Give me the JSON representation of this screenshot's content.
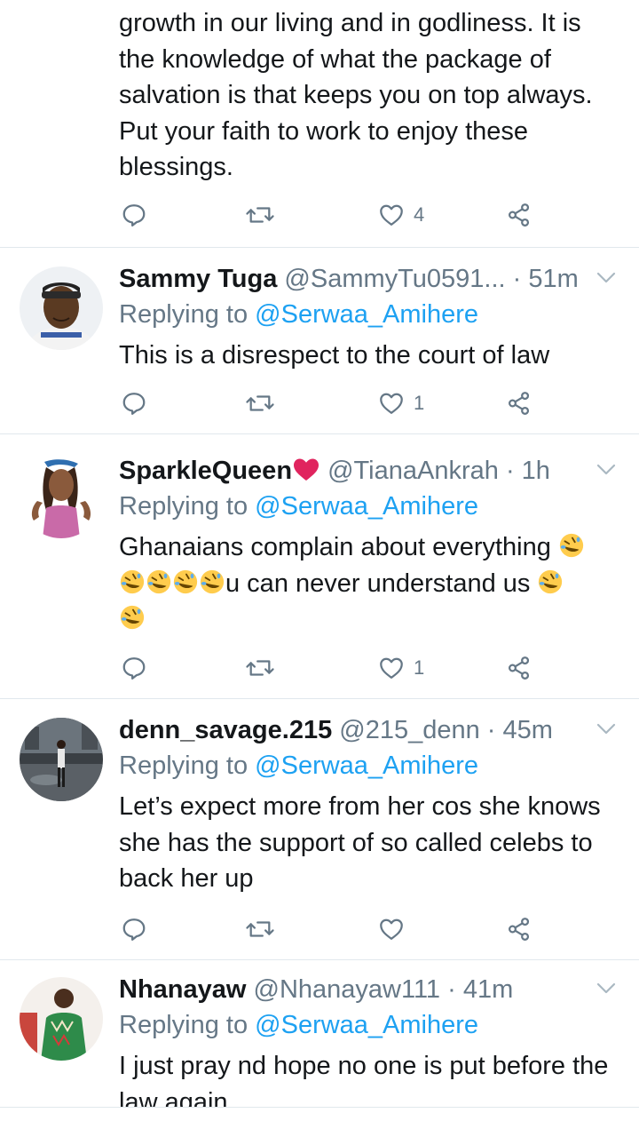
{
  "top_tweet": {
    "lines": [
      "growth in our living and in godliness. It is",
      "the knowledge of what the package of",
      "salvation is that keeps you on top always.",
      "Put your faith to work to enjoy these",
      "blessings."
    ],
    "likes": "4"
  },
  "replies": [
    {
      "name": "Sammy Tuga",
      "handle": "@SammyTu0591...",
      "time": "· 51m",
      "replying_prefix": "Replying to ",
      "replying_to": "@Serwaa_Amihere",
      "text": [
        "This is a disrespect to the court of law"
      ],
      "likes": "1"
    },
    {
      "name": "SparkleQueen",
      "handle": "@TianaAnkrah",
      "time": "· 1h",
      "replying_prefix": "Replying to ",
      "replying_to": "@Serwaa_Amihere",
      "text_parts": {
        "line1": "Ghanaians complain about everything",
        "line2": "u can never understand us"
      },
      "likes": "1"
    },
    {
      "name": "denn_savage.215",
      "handle": "@215_denn",
      "time": "· 45m",
      "replying_prefix": "Replying to ",
      "replying_to": "@Serwaa_Amihere",
      "text": [
        "Let’s expect more from her cos she knows",
        "she has the support of so called celebs to",
        "back her up"
      ],
      "likes": ""
    },
    {
      "name": "Nhanayaw",
      "handle": "@Nhanayaw111",
      "time": "· 41m",
      "replying_prefix": "Replying to ",
      "replying_to": "@Serwaa_Amihere",
      "text": [
        "I just pray nd hope no one is put before the",
        "law again"
      ]
    }
  ],
  "icons": {
    "reply": "reply-icon",
    "retweet": "retweet-icon",
    "like": "heart-icon",
    "share": "share-icon",
    "caret": "chevron-down-icon",
    "emoji": "rolling-laughing-emoji"
  },
  "colors": {
    "text": "#14171a",
    "muted": "#657786",
    "link": "#1da1f2",
    "divider": "#e1e8ed",
    "heart_emoji": "#e0245e"
  }
}
